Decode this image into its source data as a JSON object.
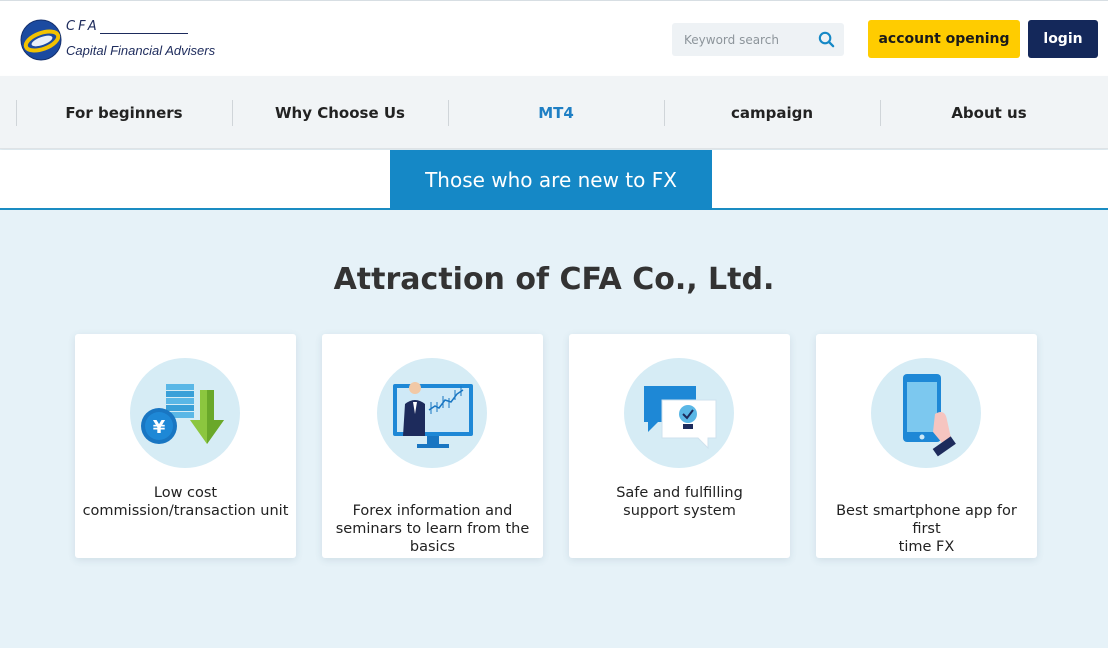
{
  "header": {
    "logo": {
      "abbr": "CFA",
      "name": "Capital Financial Advisers"
    },
    "search": {
      "placeholder": "Keyword search",
      "icon": "search-icon"
    },
    "account_opening_label": "account opening",
    "login_label": "login"
  },
  "nav": {
    "items": [
      {
        "label": "For beginners",
        "active": false
      },
      {
        "label": "Why Choose Us",
        "active": false
      },
      {
        "label": "MT4",
        "active": true
      },
      {
        "label": "campaign",
        "active": false
      },
      {
        "label": "About us",
        "active": false
      }
    ]
  },
  "band": {
    "tab_label": "Those who are new to FX"
  },
  "section": {
    "title": "Attraction of CFA Co., Ltd.",
    "cards": [
      {
        "icon": "yen-coins-down-arrow-icon",
        "lines": [
          "Low cost",
          "commission/transaction unit"
        ]
      },
      {
        "icon": "presenter-chart-screen-icon",
        "lines": [
          "Forex information and",
          "seminars to learn from the",
          "basics"
        ]
      },
      {
        "icon": "chat-bubble-lightbulb-icon",
        "lines": [
          "Safe and fulfilling",
          "support system"
        ]
      },
      {
        "icon": "smartphone-hand-icon",
        "lines": [
          "Best smartphone app for first",
          "time FX"
        ]
      }
    ]
  },
  "colors": {
    "brand_navy": "#14285a",
    "accent_yellow": "#ffcc00",
    "accent_blue": "#1588c6",
    "active_nav": "#1f7fc4",
    "section_bg": "#e6f2f8"
  }
}
